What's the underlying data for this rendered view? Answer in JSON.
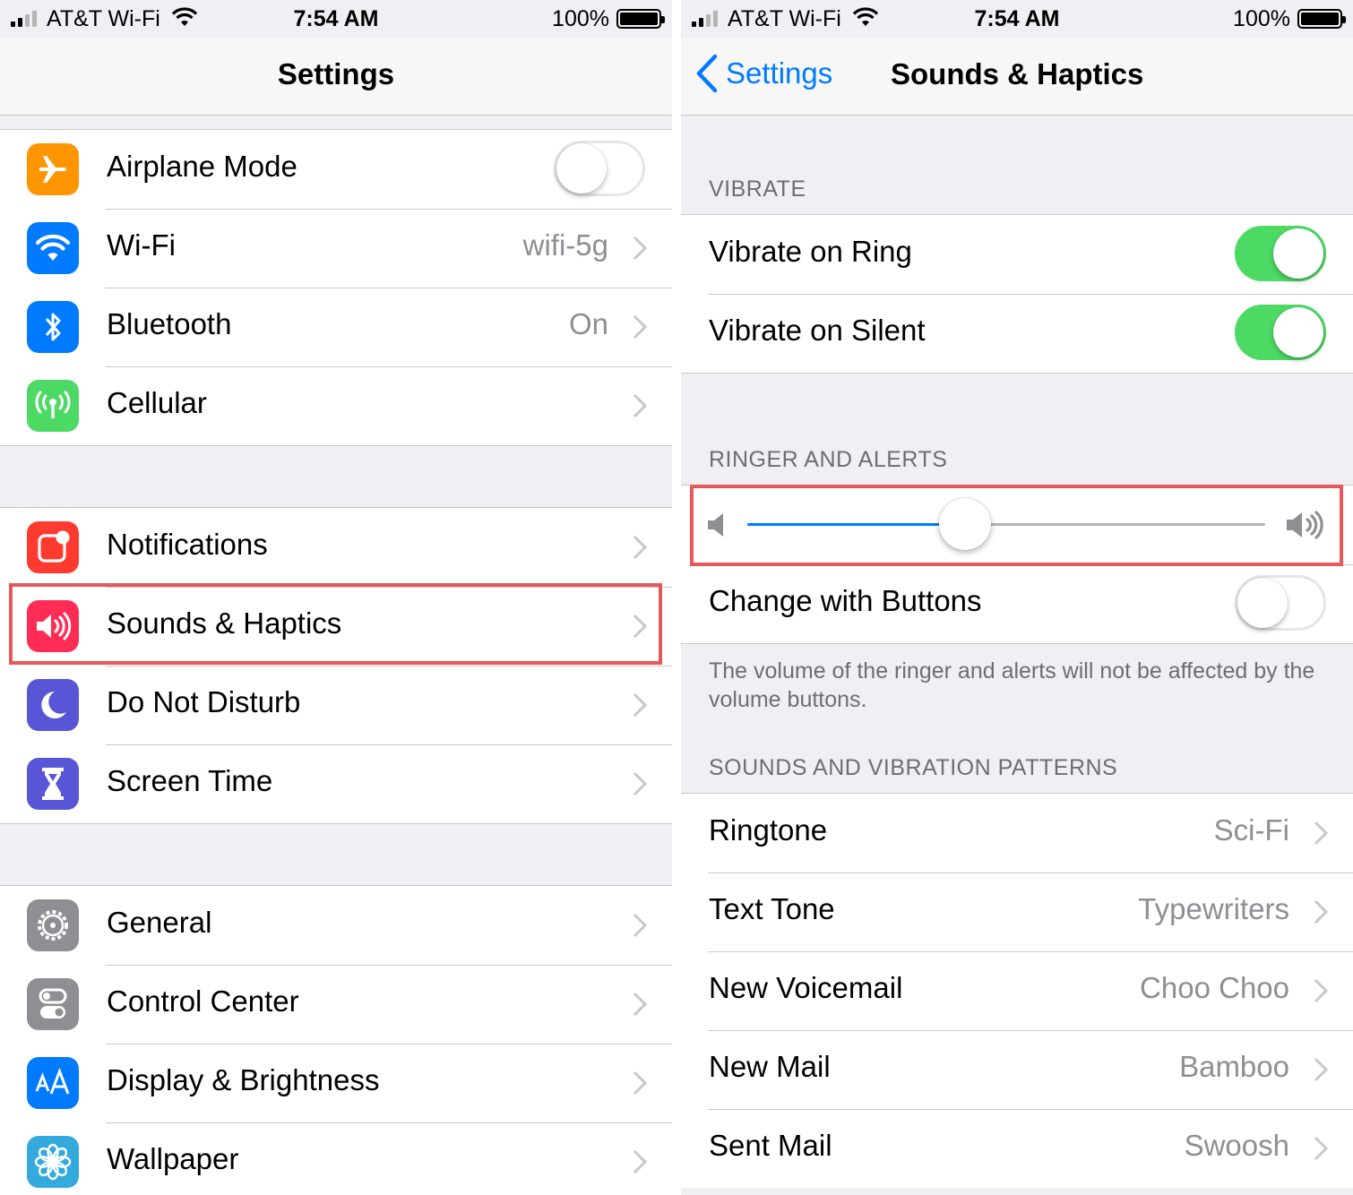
{
  "status_bar": {
    "carrier": "AT&T Wi-Fi",
    "time": "7:54 AM",
    "battery": "100%"
  },
  "left": {
    "title": "Settings",
    "group1": [
      {
        "label": "Airplane Mode",
        "icon": "airplane-icon",
        "color": "#ff9500",
        "toggle": false
      },
      {
        "label": "Wi-Fi",
        "value": "wifi-5g",
        "icon": "wifi-icon",
        "color": "#007aff"
      },
      {
        "label": "Bluetooth",
        "value": "On",
        "icon": "bluetooth-icon",
        "color": "#007aff"
      },
      {
        "label": "Cellular",
        "icon": "cellular-icon",
        "color": "#4cd964"
      }
    ],
    "group2": [
      {
        "label": "Notifications",
        "icon": "notifications-icon",
        "color": "#ff3b30"
      },
      {
        "label": "Sounds & Haptics",
        "icon": "speaker-icon",
        "color": "#ff2d55",
        "highlighted": true
      },
      {
        "label": "Do Not Disturb",
        "icon": "moon-icon",
        "color": "#5856d6"
      },
      {
        "label": "Screen Time",
        "icon": "hourglass-icon",
        "color": "#5856d6"
      }
    ],
    "group3": [
      {
        "label": "General",
        "icon": "gear-icon",
        "color": "#8e8e93"
      },
      {
        "label": "Control Center",
        "icon": "switches-icon",
        "color": "#8e8e93"
      },
      {
        "label": "Display & Brightness",
        "icon": "text-size-icon",
        "color": "#007aff"
      },
      {
        "label": "Wallpaper",
        "icon": "flower-icon",
        "color": "#34aadc"
      }
    ]
  },
  "right": {
    "back_label": "Settings",
    "title": "Sounds & Haptics",
    "vibrate_header": "VIBRATE",
    "vibrate_on_ring": {
      "label": "Vibrate on Ring",
      "on": true
    },
    "vibrate_on_silent": {
      "label": "Vibrate on Silent",
      "on": true
    },
    "ringer_header": "RINGER AND ALERTS",
    "ringer_volume": 0.42,
    "change_with_buttons": {
      "label": "Change with Buttons",
      "on": false
    },
    "ringer_footer": "The volume of the ringer and alerts will not be affected by the volume buttons.",
    "patterns_header": "SOUNDS AND VIBRATION PATTERNS",
    "patterns": [
      {
        "label": "Ringtone",
        "value": "Sci-Fi"
      },
      {
        "label": "Text Tone",
        "value": "Typewriters"
      },
      {
        "label": "New Voicemail",
        "value": "Choo Choo"
      },
      {
        "label": "New Mail",
        "value": "Bamboo"
      },
      {
        "label": "Sent Mail",
        "value": "Swoosh"
      }
    ],
    "highlight_color": "#e8585a"
  }
}
